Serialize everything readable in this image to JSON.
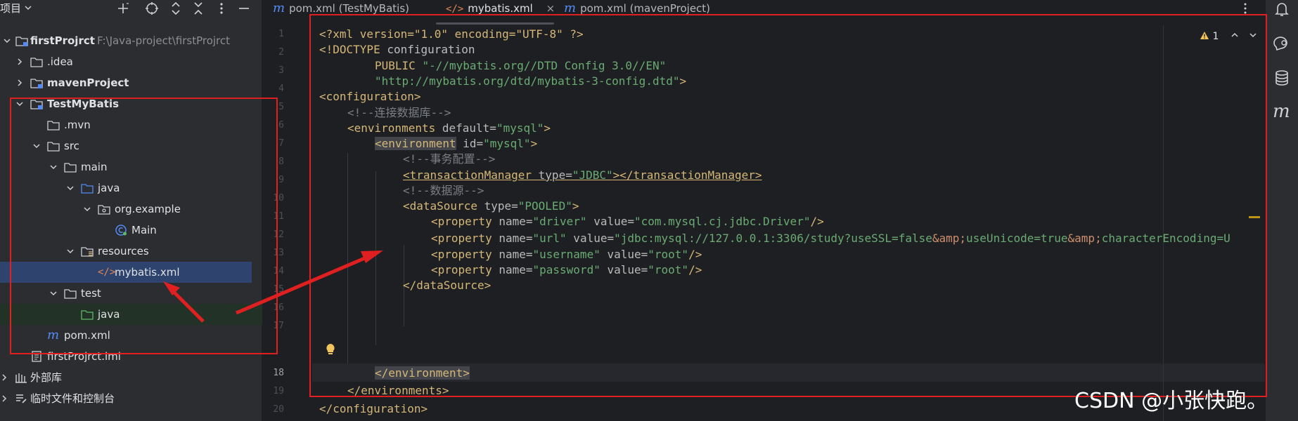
{
  "project_panel": {
    "title": "项目",
    "tree": [
      {
        "label": "firstProjrct",
        "sub": "F:\\Java-project\\firstProjrct",
        "bold": true,
        "expanded": true,
        "icon": "module-folder-icon"
      },
      {
        "label": ".idea",
        "expanded": false,
        "icon": "folder-icon"
      },
      {
        "label": "mavenProject",
        "bold": true,
        "expanded": false,
        "icon": "module-folder-icon"
      },
      {
        "label": "TestMyBatis",
        "bold": true,
        "expanded": true,
        "icon": "module-folder-icon"
      },
      {
        "label": ".mvn",
        "icon": "folder-icon"
      },
      {
        "label": "src",
        "expanded": true,
        "icon": "folder-icon"
      },
      {
        "label": "main",
        "expanded": true,
        "icon": "folder-icon"
      },
      {
        "label": "java",
        "expanded": true,
        "icon": "source-folder-icon"
      },
      {
        "label": "org.example",
        "expanded": true,
        "icon": "package-icon"
      },
      {
        "label": "Main",
        "icon": "class-icon"
      },
      {
        "label": "resources",
        "expanded": true,
        "icon": "resources-folder-icon"
      },
      {
        "label": "mybatis.xml",
        "icon": "xml-file-icon",
        "selected": true
      },
      {
        "label": "test",
        "expanded": true,
        "icon": "folder-icon"
      },
      {
        "label": "java",
        "icon": "test-source-folder-icon"
      },
      {
        "label": "pom.xml",
        "icon": "maven-icon"
      },
      {
        "label": "firstProjrct.iml",
        "icon": "iml-file-icon"
      },
      {
        "label": "外部库",
        "expanded": false,
        "icon": "library-icon"
      },
      {
        "label": "临时文件和控制台",
        "expanded": false,
        "icon": "scratches-icon"
      }
    ]
  },
  "tabs": [
    {
      "label": "pom.xml (TestMyBatis)",
      "icon": "maven-icon"
    },
    {
      "label": "mybatis.xml",
      "icon": "xml-file-icon",
      "active": true,
      "close": "×"
    },
    {
      "label": "pom.xml (mavenProject)",
      "icon": "maven-icon"
    }
  ],
  "editor": {
    "line_numbers": [
      "1",
      "2",
      "3",
      "4",
      "5",
      "6",
      "7",
      "8",
      "9",
      "10",
      "11",
      "12",
      "13",
      "14",
      "15",
      "16",
      "17",
      "18",
      "19",
      "20"
    ],
    "current_line": "18",
    "inspection": {
      "count": "1",
      "icon": "warning-icon"
    },
    "code": {
      "l1": {
        "text": "<?xml version=\"1.0\" encoding=\"UTF-8\" ?>"
      },
      "l2": {
        "a": "<!DOCTYPE",
        "b": " configuration"
      },
      "l3": {
        "a": "PUBLIC ",
        "b": "\"-//mybatis.org//DTD Config 3.0//EN\""
      },
      "l4": {
        "a": "\"http://mybatis.org/dtd/mybatis-3-config.dtd\"",
        "b": ">"
      },
      "l5": {
        "a": "<configuration>"
      },
      "l6": {
        "a": "<!--连接数据库-->"
      },
      "l7": {
        "a": "<environments",
        "b": " default=",
        "c": "\"mysql\"",
        "d": ">"
      },
      "l8": {
        "a": "<environment",
        "b": " id=",
        "c": "\"mysql\"",
        "d": ">"
      },
      "l9": {
        "a": "<!--事务配置-->"
      },
      "l10": {
        "a": "<transactionManager",
        "b": " type=",
        "c": "\"JDBC\"",
        "d": "></transactionManager>"
      },
      "l11": {
        "a": "<!--数据源-->"
      },
      "l12": {
        "a": "<dataSource",
        "b": " type=",
        "c": "\"POOLED\"",
        "d": ">"
      },
      "l13": {
        "a": "<property",
        "b": " name=",
        "c": "\"driver\"",
        "d": " value=",
        "e": "\"com.mysql.cj.jdbc.Driver\"",
        "f": "/>"
      },
      "l14": {
        "a": "<property",
        "b": " name=",
        "c": "\"url\"",
        "d": " value=",
        "e1": "\"jdbc:mysql://127.0.0.1:3306/study?useSSL=false",
        "amp1": "&amp;",
        "e2": "useUnicode=true",
        "amp2": "&amp;",
        "e3": "characterEncoding=U"
      },
      "l15": {
        "a": "<property",
        "b": " name=",
        "c": "\"username\"",
        "d": " value=",
        "e": "\"root\"",
        "f": "/>"
      },
      "l16": {
        "a": "<property",
        "b": " name=",
        "c": "\"password\"",
        "d": " value=",
        "e": "\"root\"",
        "f": "/>"
      },
      "l17": {
        "a": "</dataSource>"
      },
      "l18": {
        "a": "</environment>"
      },
      "l19": {
        "a": "</environments>"
      },
      "l20": {
        "a": "</configuration>"
      }
    }
  },
  "watermark": "CSDN @小张快跑。",
  "colors": {
    "annotation": "#e02020",
    "tag": "#d5b778",
    "string": "#6aab73",
    "comment": "#7a7e85",
    "selection": "#2e436e"
  }
}
